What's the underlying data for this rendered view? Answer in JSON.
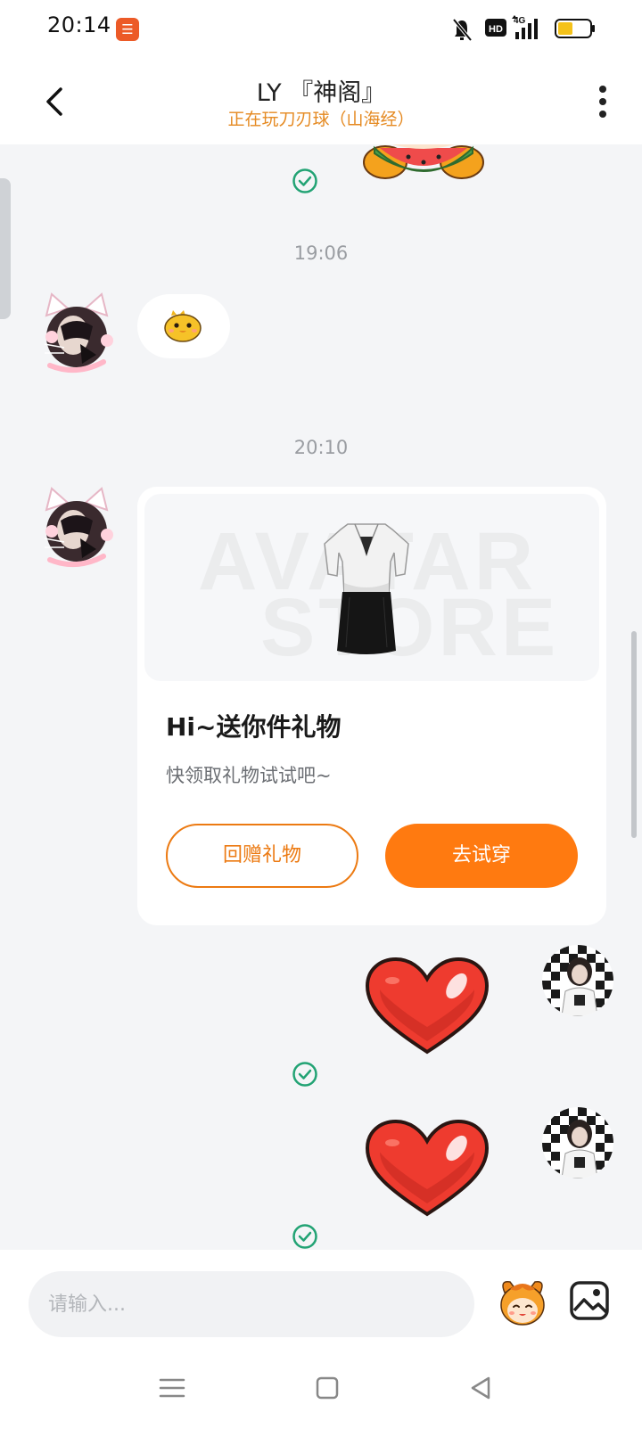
{
  "status_bar": {
    "time": "20:14",
    "app_icon": "app-notification-icon",
    "hd_badge": "HD",
    "network": "4G",
    "icons": [
      "mute-bell-icon",
      "hd-icon",
      "signal-icon",
      "battery-icon"
    ]
  },
  "header": {
    "title": "LY 『神阁』",
    "subtitle": "正在玩刀刃球（山海经）"
  },
  "messages": {
    "timestamp_1": "19:06",
    "timestamp_2": "20:10"
  },
  "gift_card": {
    "watermark_line1": "AVATAR",
    "watermark_line2": "STORE",
    "title": "Hi~送你件礼物",
    "subtitle": "快领取礼物试试吧~",
    "return_gift_label": "回赠礼物",
    "try_on_label": "去试穿"
  },
  "input": {
    "placeholder": "请输入..."
  },
  "colors": {
    "accent_orange": "#ff7a10",
    "subtitle_orange": "#e58a22",
    "check_green": "#22a374",
    "background": "#f4f5f7"
  }
}
